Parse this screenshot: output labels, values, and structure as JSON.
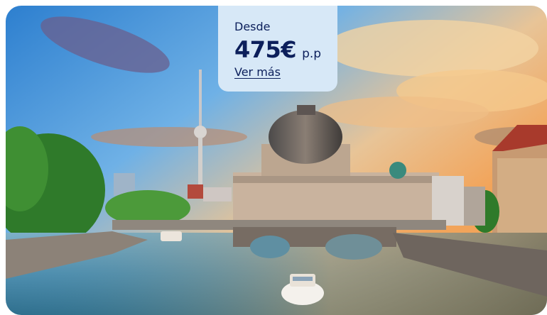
{
  "offer": {
    "from_label": "Desde",
    "price": "475€",
    "per_person": "p.p",
    "more_link": "Ver más"
  },
  "colors": {
    "panel_bg": "#d7e8f7",
    "panel_text": "#0c1f5b"
  },
  "image": {
    "icon": "berlin-photo"
  }
}
